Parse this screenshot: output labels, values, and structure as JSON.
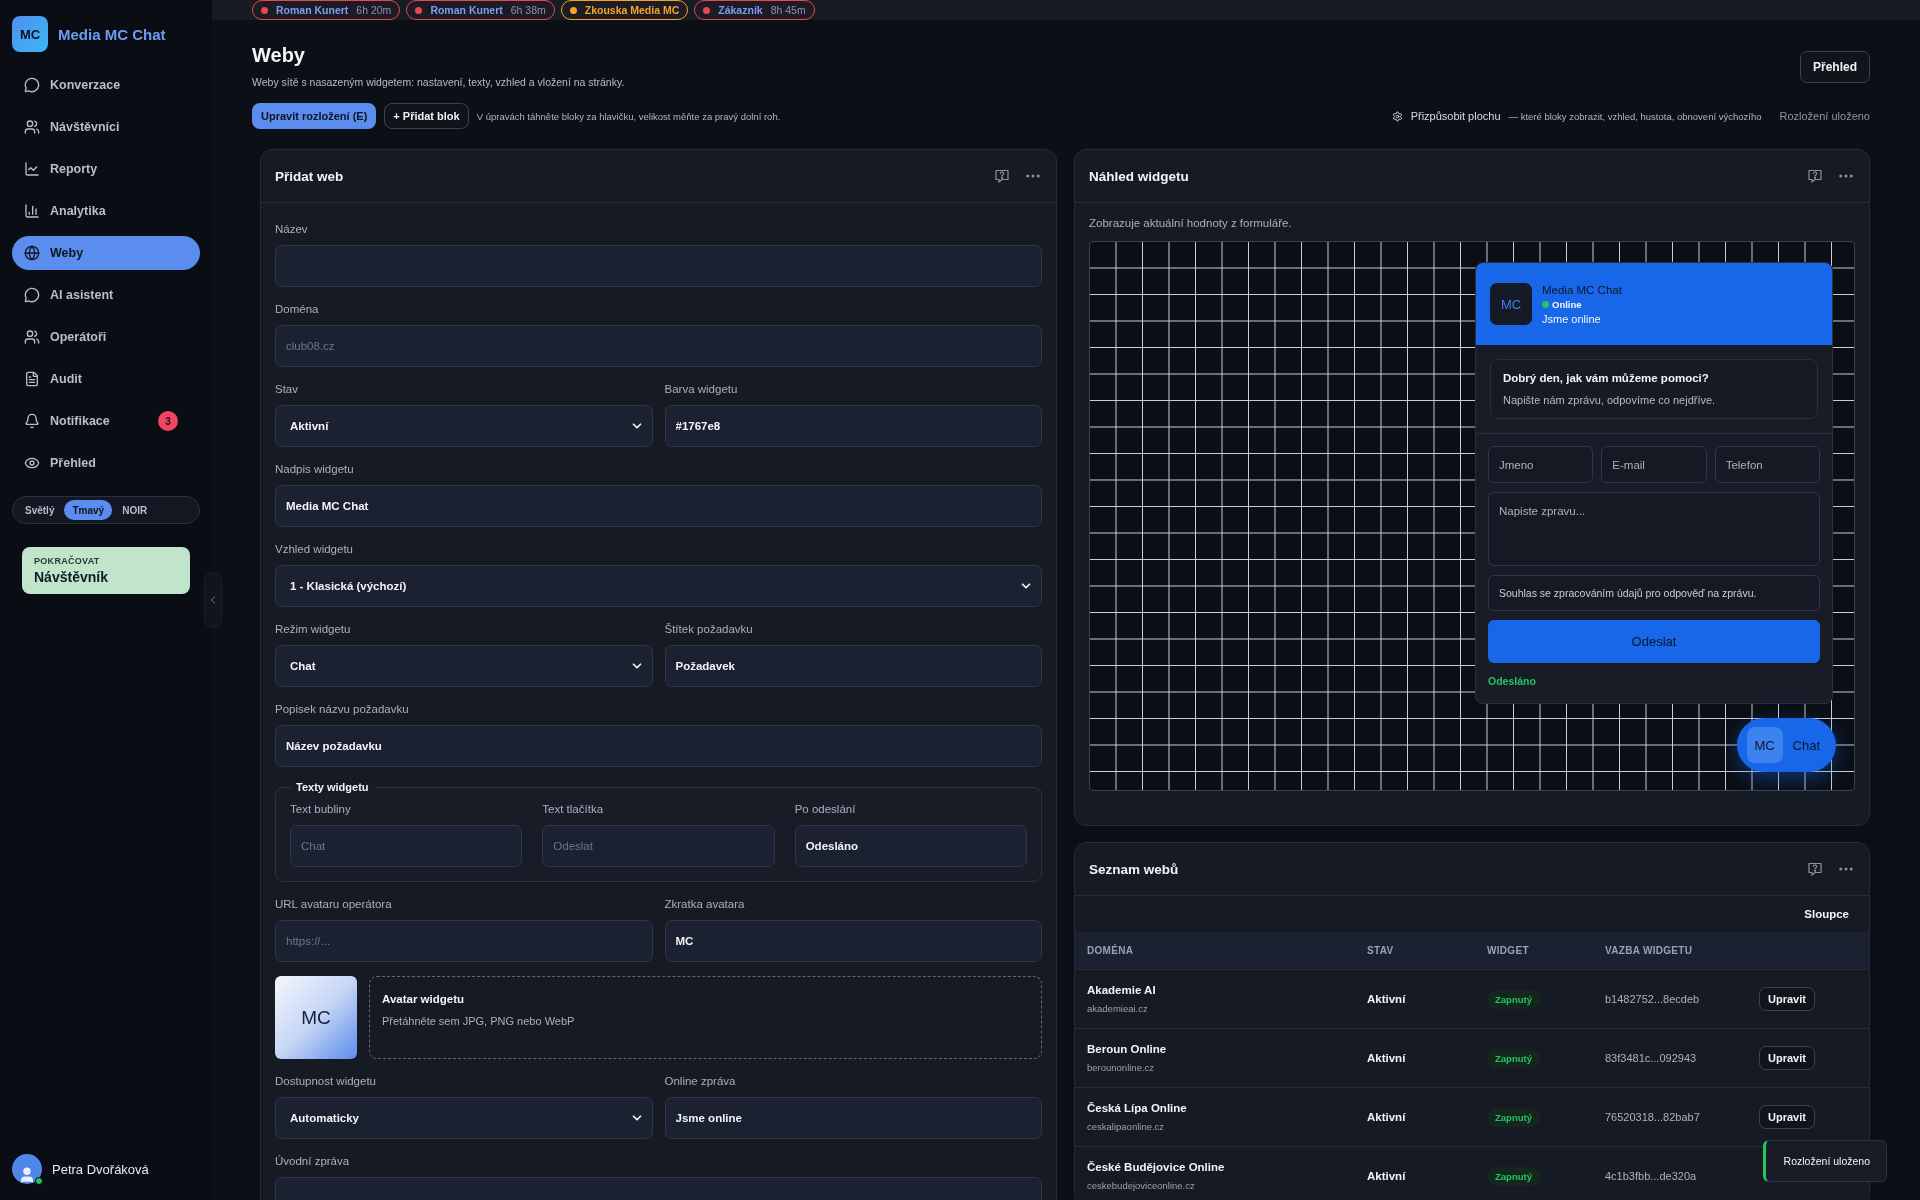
{
  "sidebar": {
    "logo": "MC",
    "brand": "Media MC Chat",
    "items": [
      {
        "label": "Konverzace",
        "selected": false
      },
      {
        "label": "Návštěvníci",
        "selected": false
      },
      {
        "label": "Reporty",
        "selected": false
      },
      {
        "label": "Analytika",
        "selected": false
      },
      {
        "label": "Weby",
        "selected": true
      },
      {
        "label": "AI asistent",
        "selected": false
      },
      {
        "label": "Operátoři",
        "selected": false
      },
      {
        "label": "Audit",
        "selected": false
      },
      {
        "label": "Notifikace",
        "selected": false,
        "badge": "3"
      },
      {
        "label": "Přehled",
        "selected": false
      }
    ],
    "theme_switch": [
      {
        "label": "Světlý",
        "selected": false
      },
      {
        "label": "Tmavý",
        "selected": true
      },
      {
        "label": "NOIR",
        "selected": false
      }
    ],
    "resume_card": {
      "caption": "POKRAČOVAT",
      "title": "Návštěvník"
    },
    "user": {
      "name": "Petra Dvořáková"
    }
  },
  "session_tabs": [
    {
      "name": "Roman Kunert",
      "time": "6h 20m",
      "color": "#e5484d",
      "selected": false
    },
    {
      "name": "Roman Kunert",
      "time": "6h 38m",
      "color": "#e5484d",
      "selected": false
    },
    {
      "name": "Zkouska Media MC",
      "color": "#f5a524",
      "selected": true
    },
    {
      "name": "Zákazník",
      "time": "8h 45m",
      "color": "#e5484d",
      "selected": false
    }
  ],
  "header": {
    "title": "Weby",
    "subtitle": "Weby sítě s nasazeným widgetem: nastavení, texty, vzhled a vložení na stránky.",
    "overview_button": "Přehled",
    "edit_layout_button": "Upravit rozložení (E)",
    "add_block_button": "+ Přidat blok",
    "hint": "V úpravách táhněte bloky za hlavičku, velikost měňte za pravý dolní roh.",
    "customize_link": "Přizpůsobit plochu",
    "customize_hint": "— které bloky zobrazit, vzhled, hustota, obnovení výchozího",
    "layout_status": "Rozložení uloženo"
  },
  "add_web": {
    "title": "Přidat web",
    "form": [
      {
        "kind": "row",
        "fields": [
          {
            "label": "Název",
            "kind": "text"
          }
        ]
      },
      {
        "kind": "row",
        "fields": [
          {
            "label": "Doména",
            "kind": "text",
            "placeholder": "club08.cz"
          }
        ]
      },
      {
        "kind": "row",
        "fields": [
          {
            "label": "Stav",
            "kind": "select",
            "value": "Aktivní"
          },
          {
            "label": "Barva widgetu",
            "kind": "text",
            "value": "#1767e8"
          }
        ]
      },
      {
        "kind": "row",
        "fields": [
          {
            "label": "Nadpis widgetu",
            "kind": "text",
            "value": "Media MC Chat"
          }
        ]
      },
      {
        "kind": "row",
        "fields": [
          {
            "label": "Vzhled widgetu",
            "kind": "select",
            "value": "1 - Klasická (výchozí)"
          }
        ]
      },
      {
        "kind": "row",
        "fields": [
          {
            "label": "Režim widgetu",
            "kind": "select",
            "value": "Chat"
          },
          {
            "label": "Štítek požadavku",
            "kind": "text",
            "value": "Požadavek"
          }
        ]
      },
      {
        "kind": "row",
        "fields": [
          {
            "label": "Popisek názvu požadavku",
            "kind": "text",
            "value": "Název požadavku"
          }
        ]
      },
      {
        "kind": "group",
        "legend": "Texty widgetu",
        "fields": [
          {
            "label": "Text bubliny",
            "kind": "text",
            "placeholder": "Chat"
          },
          {
            "label": "Text tlačítka",
            "kind": "text",
            "placeholder": "Odeslat"
          },
          {
            "label": "Po odeslání",
            "kind": "text",
            "value": "Odesláno"
          }
        ]
      },
      {
        "kind": "row",
        "fields": [
          {
            "label": "URL avataru operátora",
            "kind": "text",
            "placeholder": "https://..."
          },
          {
            "label": "Zkratka avatara",
            "kind": "text",
            "value": "MC"
          }
        ]
      },
      {
        "kind": "avatar",
        "initials": "MC",
        "title": "Avatar widgetu",
        "hint": "Přetáhněte sem JPG, PNG nebo WebP"
      },
      {
        "kind": "row",
        "fields": [
          {
            "label": "Dostupnost widgetu",
            "kind": "select",
            "value": "Automaticky"
          },
          {
            "label": "Online zpráva",
            "kind": "text",
            "value": "Jsme online"
          }
        ]
      },
      {
        "kind": "row",
        "fields": [
          {
            "label": "Úvodní zpráva",
            "kind": "text"
          }
        ]
      }
    ]
  },
  "preview": {
    "title": "Náhled widgetu",
    "caption": "Zobrazuje aktuální hodnoty z formuláře.",
    "widget": {
      "avatar": "MC",
      "title": "Media MC Chat",
      "status": "Online",
      "online_message": "Jsme online",
      "greeting_title": "Dobrý den, jak vám můžeme pomoci?",
      "greeting_text": "Napište nám zprávu, odpovíme co nejdříve.",
      "fields": [
        {
          "placeholder": "Jmeno"
        },
        {
          "placeholder": "E-mail"
        },
        {
          "placeholder": "Telefon"
        }
      ],
      "message_placeholder": "Napiste zpravu...",
      "consent": "Souhlas se zpracováním údajů pro odpověď na zprávu.",
      "send_button": "Odeslat",
      "sent_text": "Odesláno"
    },
    "bubble": {
      "avatar": "MC",
      "label": "Chat"
    }
  },
  "sites": {
    "title": "Seznam webů",
    "columns_button": "Sloupce",
    "columns": [
      "DOMÉNA",
      "STAV",
      "WIDGET",
      "VAZBA WIDGETU"
    ],
    "rows": [
      {
        "name": "Akademie AI",
        "domain": "akademieai.cz",
        "status": "Aktivní",
        "widget": "Zapnutý",
        "binding": "b1482752...8ecdeb",
        "action": "Upravit"
      },
      {
        "name": "Beroun Online",
        "domain": "berounonline.cz",
        "status": "Aktivní",
        "widget": "Zapnutý",
        "binding": "83f3481c...092943",
        "action": "Upravit"
      },
      {
        "name": "Česká Lípa Online",
        "domain": "ceskalipaonline.cz",
        "status": "Aktivní",
        "widget": "Zapnutý",
        "binding": "76520318...82bab7",
        "action": "Upravit"
      },
      {
        "name": "České Budějovice Online",
        "domain": "ceskebudejoviceonline.cz",
        "status": "Aktivní",
        "widget": "Zapnutý",
        "binding": "4c1b3fbb...de320a"
      }
    ]
  },
  "toast": {
    "text": "Rozložení uloženo"
  }
}
